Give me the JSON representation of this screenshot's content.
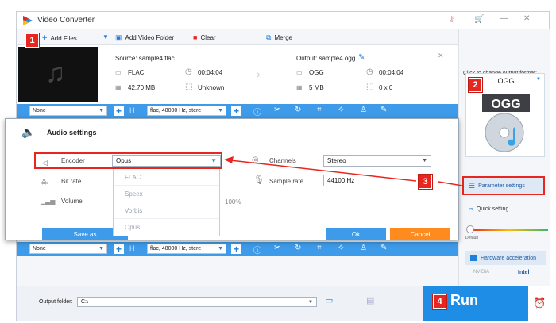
{
  "title": "Video Converter",
  "toolbar": {
    "add_files": "Add Files",
    "add_video_folder": "Add Video Folder",
    "clear": "Clear",
    "merge": "Merge"
  },
  "source": {
    "label": "Source: sample4.flac",
    "format": "FLAC",
    "duration": "00:04:04",
    "size": "42.70 MB",
    "resolution": "Unknown"
  },
  "output": {
    "label": "Output: sample4.ogg",
    "format": "OGG",
    "duration": "00:04:04",
    "size": "5 MB",
    "resolution": "0 x 0"
  },
  "bar": {
    "subtitle": "None",
    "audio": "flac, 48000 Hz, stere"
  },
  "right": {
    "hint": "Click to change output format:",
    "format": "OGG",
    "format_icon_text": "OGG",
    "parameter_settings": "Parameter settings",
    "quick_setting": "Quick setting",
    "default": "Default",
    "hw_accel": "Hardware acceleration",
    "nvidia": "NVIDIA",
    "intel": "Intel"
  },
  "dialog": {
    "title": "Audio settings",
    "encoder_label": "Encoder",
    "encoder_value": "Opus",
    "bitrate_label": "Bit rate",
    "volume_label": "Volume",
    "volume_value": "100%",
    "channels_label": "Channels",
    "channels_value": "Stereo",
    "sample_rate_label": "Sample rate",
    "sample_rate_value": "44100 Hz",
    "save_as": "Save as",
    "ok": "Ok",
    "cancel": "Cancel",
    "encoder_options": [
      "FLAC",
      "Speex",
      "Vorbis",
      "Opus"
    ]
  },
  "bottom": {
    "output_folder_label": "Output folder:",
    "output_folder_value": "C:\\",
    "run": "Run"
  },
  "badges": [
    "1",
    "2",
    "3",
    "4"
  ],
  "colors": {
    "accent": "#1e8de6",
    "bar": "#3d9be9",
    "highlight": "#e8251e",
    "cancel": "#ff8a1e"
  }
}
